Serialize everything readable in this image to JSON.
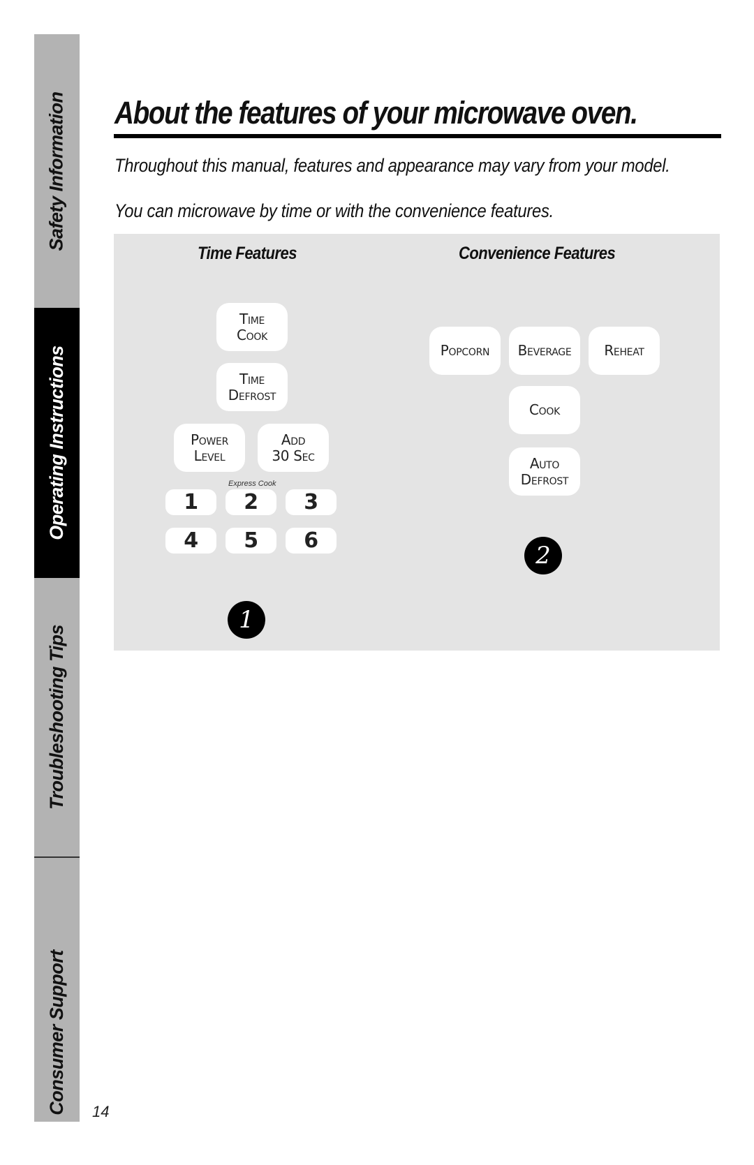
{
  "sidebar": {
    "tabs": [
      {
        "label": "Safety Information",
        "active": false
      },
      {
        "label": "Operating Instructions",
        "active": true
      },
      {
        "label": "Troubleshooting Tips",
        "active": false
      },
      {
        "label": "Consumer Support",
        "active": false
      }
    ]
  },
  "header": {
    "title": "About the features of your microwave oven.",
    "subtitles": [
      "Throughout this manual, features and appearance may vary from your model.",
      "You can microwave by time or with the convenience features."
    ]
  },
  "panel": {
    "time_features": {
      "heading": "Time Features",
      "buttons": [
        {
          "lines": [
            "Time",
            "Cook"
          ]
        },
        {
          "lines": [
            "Time",
            "Defrost"
          ]
        },
        {
          "lines": [
            "Power",
            "Level"
          ]
        },
        {
          "lines": [
            "Add",
            "30 Sec"
          ]
        }
      ],
      "express_cook_label": "Express Cook",
      "number_keys": [
        "1",
        "2",
        "3",
        "4",
        "5",
        "6"
      ],
      "callout": "1"
    },
    "convenience_features": {
      "heading": "Convenience Features",
      "buttons": [
        {
          "lines": [
            "Popcorn"
          ]
        },
        {
          "lines": [
            "Beverage"
          ]
        },
        {
          "lines": [
            "Reheat"
          ]
        },
        {
          "lines": [
            "Cook"
          ]
        },
        {
          "lines": [
            "Auto",
            "Defrost"
          ]
        }
      ],
      "callout": "2"
    }
  },
  "footer": {
    "page_number": "14"
  }
}
